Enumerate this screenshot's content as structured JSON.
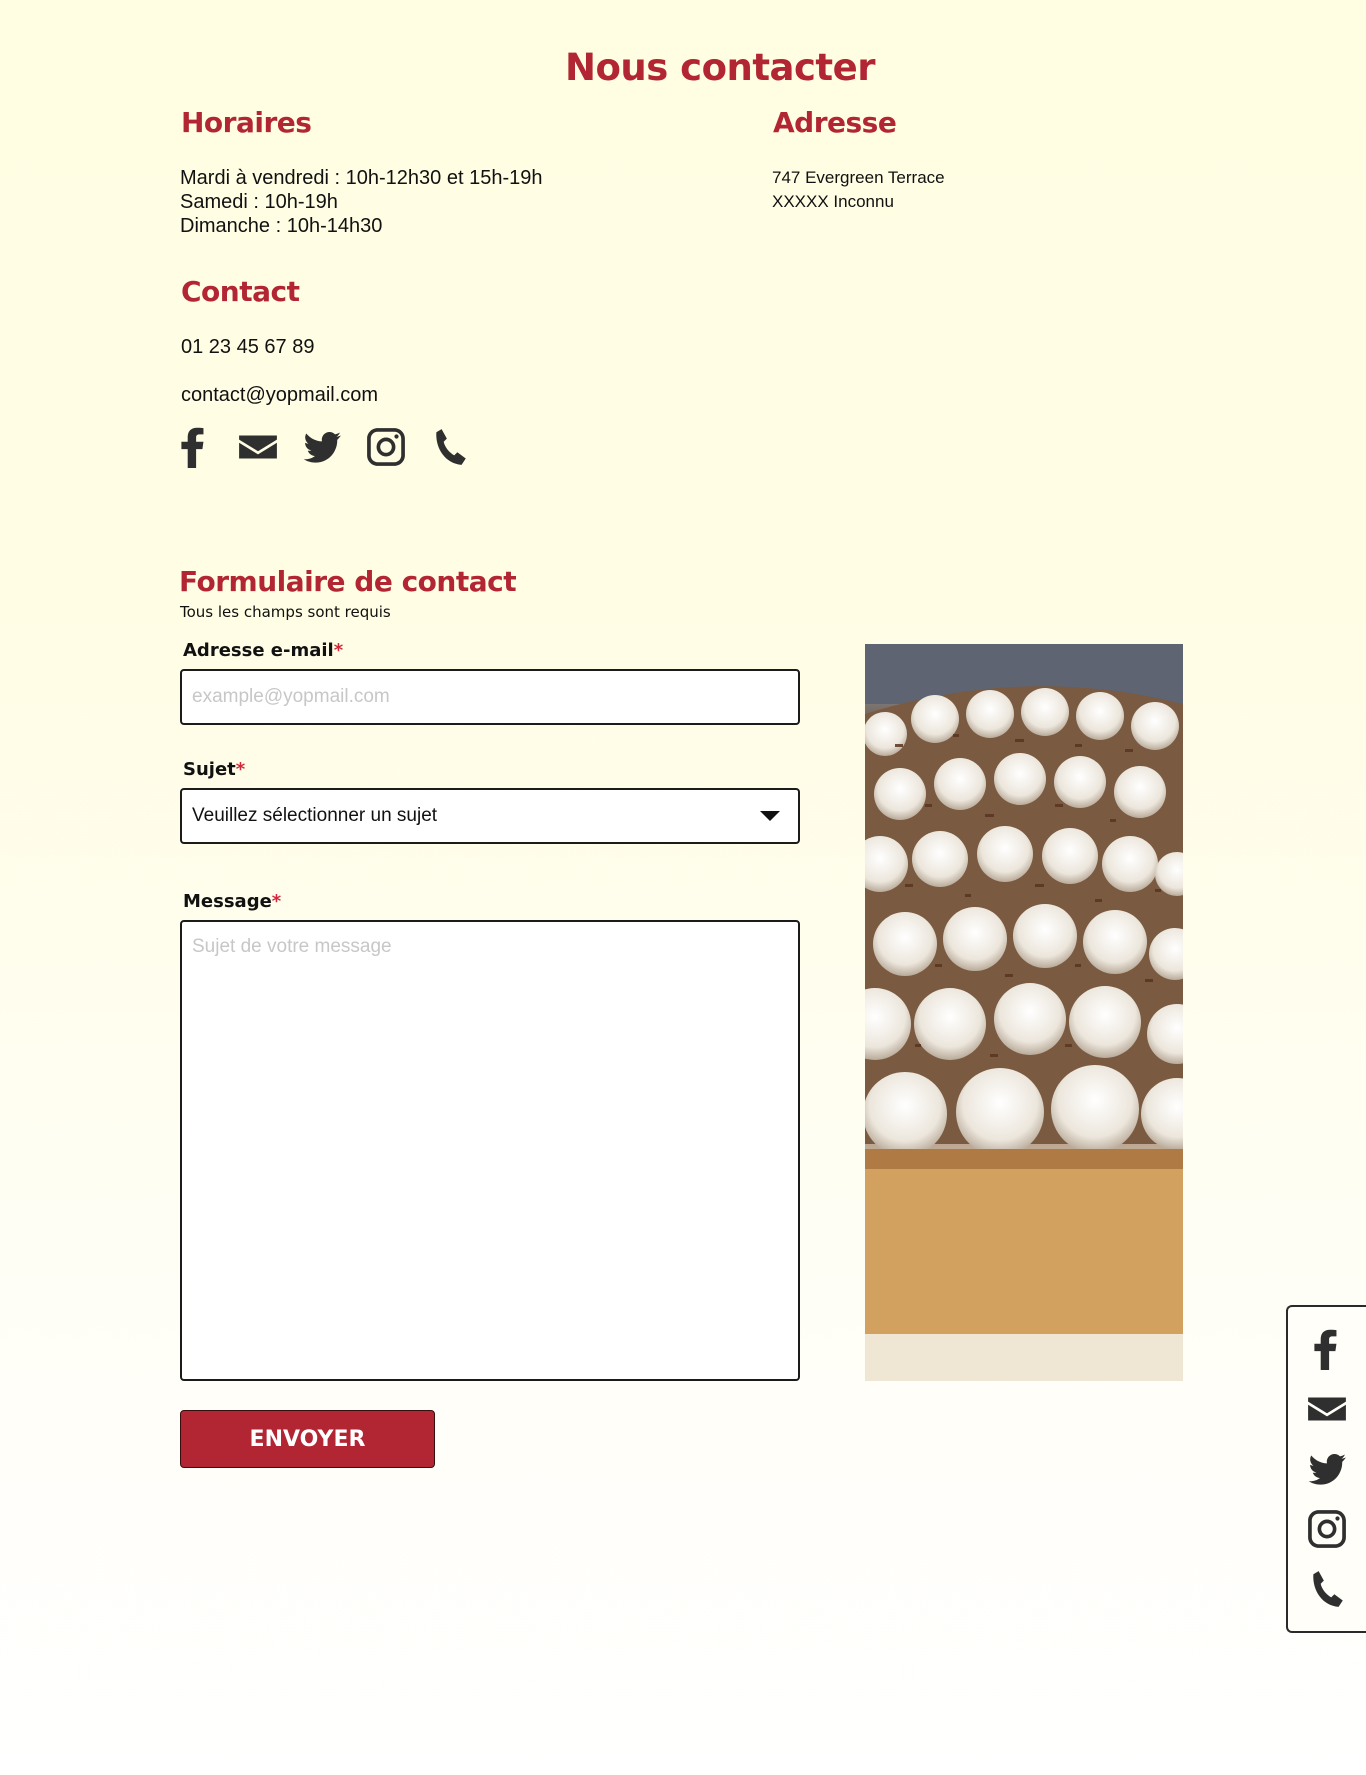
{
  "page": {
    "title": "Nous contacter"
  },
  "hours": {
    "heading": "Horaires",
    "lines": [
      "Mardi à vendredi : 10h-12h30 et 15h-19h",
      "Samedi : 10h-19h",
      "Dimanche : 10h-14h30"
    ]
  },
  "address": {
    "heading": "Adresse",
    "lines": [
      "747 Evergreen Terrace",
      "XXXXX Inconnu"
    ]
  },
  "contact": {
    "heading": "Contact",
    "phone": "01 23 45 67 89",
    "email": "contact@yopmail.com",
    "social_icons": [
      "facebook-icon",
      "mail-icon",
      "twitter-icon",
      "instagram-icon",
      "phone-icon"
    ]
  },
  "form": {
    "heading": "Formulaire de contact",
    "subtitle": "Tous les champs sont requis",
    "required_marker": "*",
    "email_label": "Adresse e-mail",
    "email_placeholder": "example@yopmail.com",
    "subject_label": "Sujet",
    "subject_selected": "Veuillez sélectionner un sujet",
    "message_label": "Message",
    "message_placeholder": "Sujet de votre message",
    "submit_label": "ENVOYER"
  },
  "image": {
    "subject": "cake-photo"
  },
  "floating_sidebar": {
    "icons": [
      "facebook-icon",
      "mail-icon",
      "twitter-icon",
      "instagram-icon",
      "phone-icon"
    ]
  },
  "colors": {
    "accent": "#b22532",
    "background": "#fffde4",
    "icon": "#2f2f2f"
  }
}
